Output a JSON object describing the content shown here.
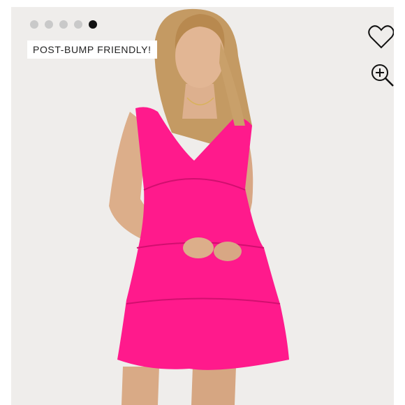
{
  "carousel": {
    "dot_count": 5,
    "active_index": 4
  },
  "badge": {
    "label": "POST-BUMP FRIENDLY!"
  },
  "actions": {
    "favorite_icon": "heart-outline-icon",
    "zoom_icon": "zoom-in-icon"
  },
  "colors": {
    "dress": "#ff1a8c",
    "background": "#efedeb",
    "active_dot": "#111111",
    "inactive_dot": "#c9c9c9"
  }
}
